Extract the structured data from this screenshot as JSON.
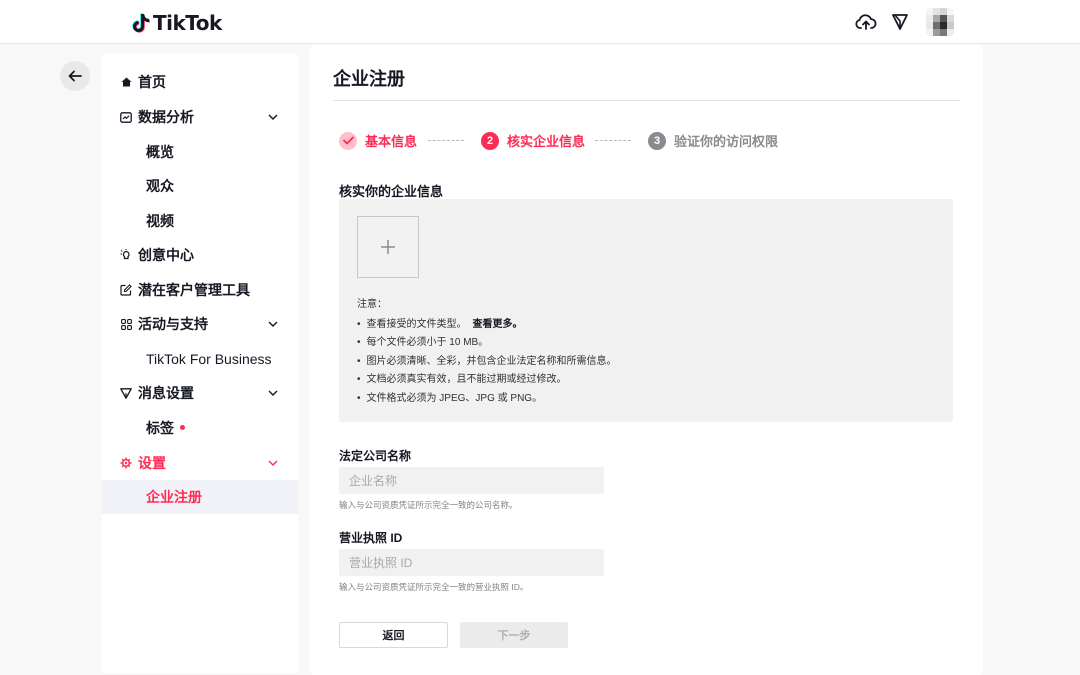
{
  "header": {
    "logo_text": "TikTok",
    "icons": [
      "cloud-upload-icon",
      "send-filter-icon"
    ]
  },
  "sidebar": {
    "items": [
      {
        "label": "首页",
        "icon": "home-icon"
      },
      {
        "label": "数据分析",
        "icon": "analytics-icon",
        "expanded": true
      },
      {
        "label": "概览"
      },
      {
        "label": "观众"
      },
      {
        "label": "视频"
      },
      {
        "label": "创意中心",
        "icon": "lightbulb-icon"
      },
      {
        "label": "潜在客户管理工具",
        "icon": "edit-icon"
      },
      {
        "label": "活动与支持",
        "icon": "apps-icon",
        "expanded": true
      },
      {
        "label": "TikTok For Business"
      },
      {
        "label": "消息设置",
        "icon": "filter-icon",
        "expanded": true
      },
      {
        "label": "标签",
        "has_dot": true
      },
      {
        "label": "设置",
        "icon": "gear-icon",
        "active": true
      },
      {
        "label": "企业注册",
        "selected": true
      }
    ]
  },
  "main": {
    "title": "企业注册",
    "steps": [
      {
        "num": "",
        "label": "基本信息",
        "status": "done"
      },
      {
        "num": "2",
        "label": "核实企业信息",
        "status": "current"
      },
      {
        "num": "3",
        "label": "验证你的访问权限",
        "status": "pending"
      }
    ],
    "section_title": "核实你的企业信息",
    "upload": {
      "note_title": "注意：",
      "notes": [
        "查看接受的文件类型。",
        "每个文件必须小于 10 MB。",
        "图片必须清晰、全彩，并包含企业法定名称和所需信息。",
        "文档必须真实有效，且不能过期或经过修改。",
        "文件格式必须为 JPEG、JPG 或 PNG。"
      ],
      "more_link": "查看更多。"
    },
    "fields": {
      "company_name": {
        "label": "法定公司名称",
        "placeholder": "企业名称",
        "value": "",
        "hint": "输入与公司资质凭证所示完全一致的公司名称。"
      },
      "license_id": {
        "label": "营业执照 ID",
        "placeholder": "营业执照 ID",
        "value": "",
        "hint": "输入与公司资质凭证所示完全一致的营业执照 ID。"
      }
    },
    "buttons": {
      "back": "返回",
      "next": "下一步"
    }
  },
  "colors": {
    "accent": "#fe2c55",
    "done_step": "#ffb3c1",
    "pending_step": "#8a8b91",
    "text": "#161823",
    "panel_gray": "#f1f1f2"
  }
}
